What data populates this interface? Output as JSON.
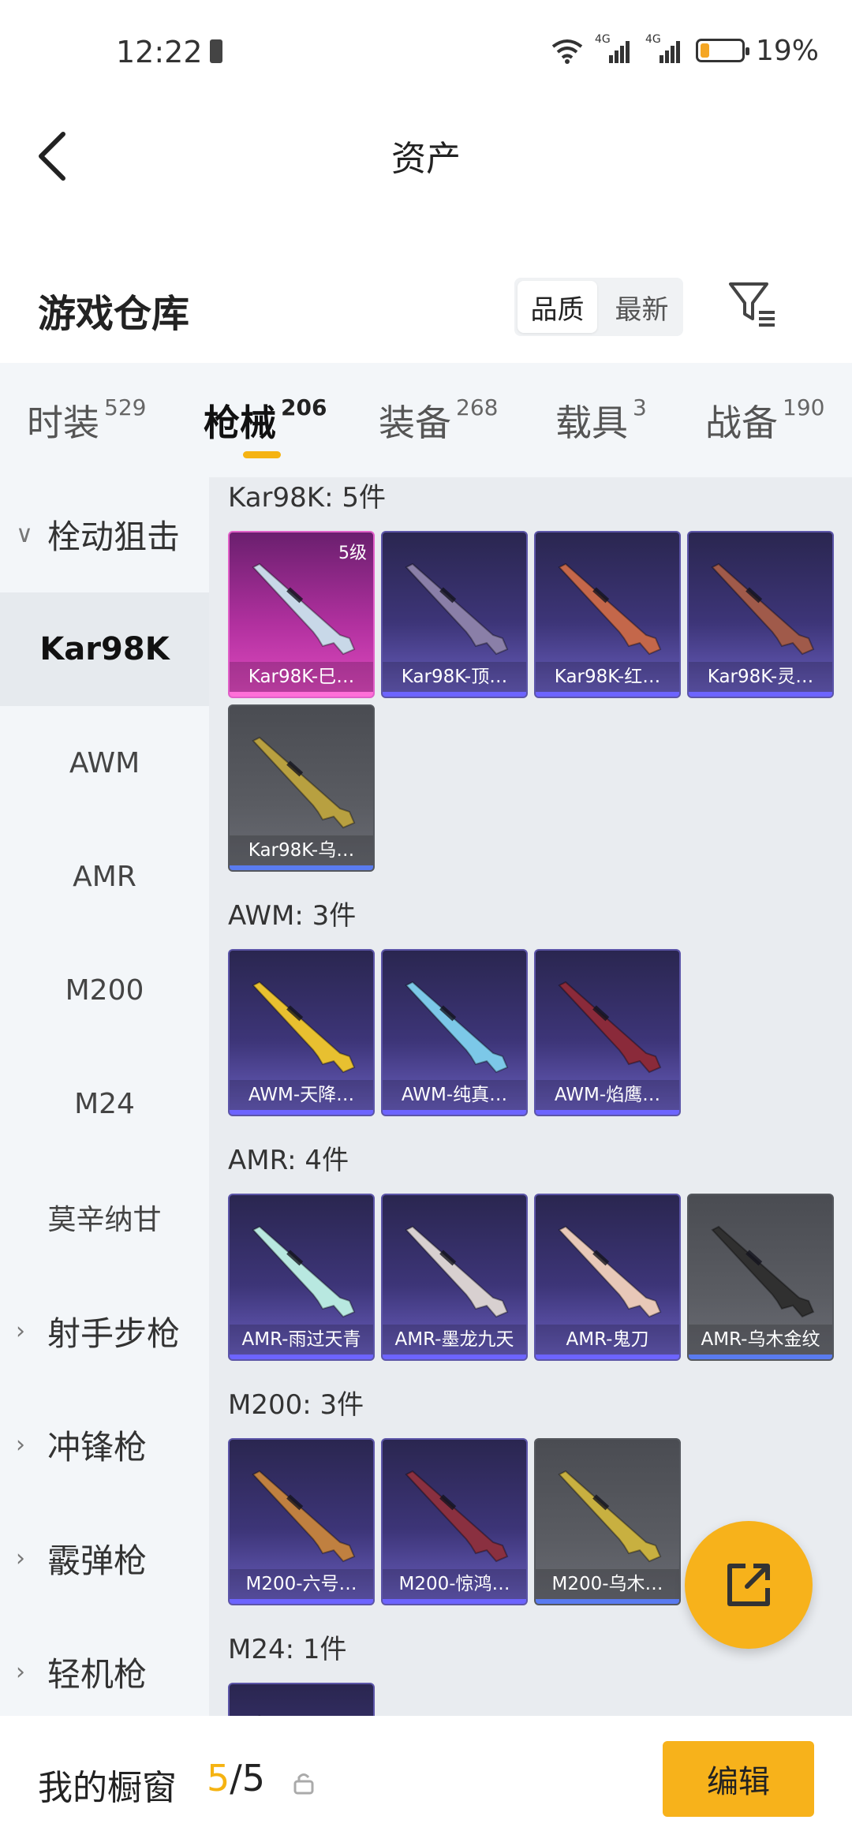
{
  "status_bar": {
    "time": "12:22",
    "network_1": "4G",
    "network_2": "4G",
    "battery_pct": "19%",
    "battery_level": 0.19
  },
  "header": {
    "title": "资产"
  },
  "warehouse": {
    "title": "游戏仓库",
    "sort_options": [
      "品质",
      "最新"
    ],
    "sort_selected": "品质"
  },
  "tabs": [
    {
      "label": "时装",
      "count": "529"
    },
    {
      "label": "枪械",
      "count": "206"
    },
    {
      "label": "装备",
      "count": "268"
    },
    {
      "label": "载具",
      "count": "3"
    },
    {
      "label": "战备",
      "count": "190"
    }
  ],
  "sidebar": {
    "items": [
      {
        "label": "栓动狙击",
        "type": "group"
      },
      {
        "label": "Kar98K",
        "type": "sub",
        "selected": true
      },
      {
        "label": "AWM",
        "type": "sub"
      },
      {
        "label": "AMR",
        "type": "sub"
      },
      {
        "label": "M200",
        "type": "sub"
      },
      {
        "label": "M24",
        "type": "sub"
      },
      {
        "label": "莫辛纳甘",
        "type": "sub"
      },
      {
        "label": "射手步枪",
        "type": "group"
      },
      {
        "label": "冲锋枪",
        "type": "group"
      },
      {
        "label": "霰弹枪",
        "type": "group"
      },
      {
        "label": "轻机枪",
        "type": "group"
      }
    ]
  },
  "groups": [
    {
      "title": "Kar98K: 5件",
      "items": [
        {
          "label": "Kar98K-巳…",
          "level": "5级",
          "style": "pink",
          "gun": "#c8d8e8"
        },
        {
          "label": "Kar98K-顶…",
          "style": "purple",
          "gun": "#8a7fa8"
        },
        {
          "label": "Kar98K-红…",
          "style": "purple",
          "gun": "#c4674a"
        },
        {
          "label": "Kar98K-灵…",
          "style": "purple",
          "gun": "#a05a4a"
        },
        {
          "label": "Kar98K-乌…",
          "style": "gray",
          "gun": "#b8a040"
        }
      ]
    },
    {
      "title": "AWM: 3件",
      "items": [
        {
          "label": "AWM-天降…",
          "style": "purple",
          "gun": "#e8c030"
        },
        {
          "label": "AWM-纯真…",
          "style": "purple",
          "gun": "#7cc8e8"
        },
        {
          "label": "AWM-焰鹰…",
          "style": "purple",
          "gun": "#8a2a3a"
        }
      ]
    },
    {
      "title": "AMR: 4件",
      "items": [
        {
          "label": "AMR-雨过天青",
          "style": "purple",
          "gun": "#b8e8e0"
        },
        {
          "label": "AMR-墨龙九天",
          "style": "purple",
          "gun": "#d8d0d0"
        },
        {
          "label": "AMR-鬼刀",
          "style": "purple",
          "gun": "#e8c8b8"
        },
        {
          "label": "AMR-乌木金纹",
          "style": "gray",
          "gun": "#303030"
        }
      ]
    },
    {
      "title": "M200: 3件",
      "items": [
        {
          "label": "M200-六号…",
          "style": "purple",
          "gun": "#c08040"
        },
        {
          "label": "M200-惊鸿…",
          "style": "purple",
          "gun": "#8a3040"
        },
        {
          "label": "M200-乌木…",
          "style": "gray",
          "gun": "#c8b040"
        }
      ]
    },
    {
      "title": "M24: 1件",
      "items": [
        {
          "label": "",
          "style": "purple",
          "gun": "#6a6a8a"
        }
      ]
    }
  ],
  "showcase": {
    "label": "我的橱窗",
    "current": "5",
    "separator": "/",
    "total": "5"
  },
  "edit_button": {
    "label": "编辑"
  },
  "colors": {
    "accent": "#f7b21b",
    "card_purple": "#3d3578",
    "card_gray": "#5a5c62",
    "card_pink": "#b0309e"
  }
}
